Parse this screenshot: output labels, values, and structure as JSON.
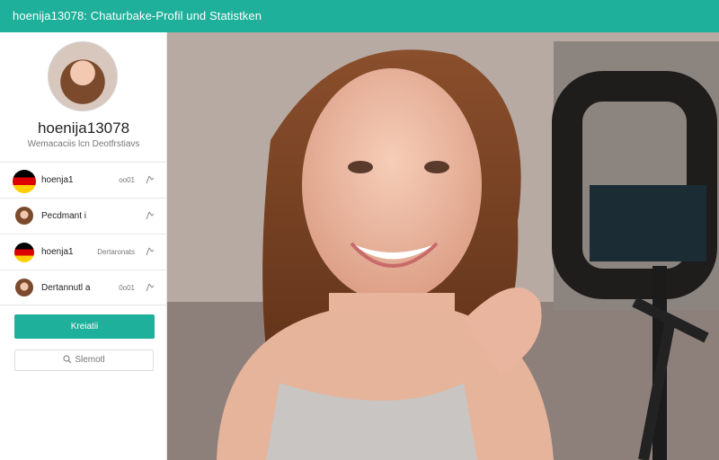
{
  "header": {
    "title": "hoenija13078: Chaturbake-Profil und Statistken"
  },
  "profile": {
    "username": "hoenija13078",
    "subtitle": "Wemacaciis lcn Deotfrstiavs"
  },
  "list": [
    {
      "icon": "germany-flag-icon",
      "name": "hoenja1",
      "meta": "oo01"
    },
    {
      "icon": "avatar-icon",
      "name": "Pecdmant i",
      "meta": ""
    },
    {
      "icon": "germany-flag-icon",
      "name": "hoenja1",
      "meta": "Dertaronats"
    },
    {
      "icon": "avatar-icon",
      "name": "Dertannutl a",
      "meta": "0o01"
    }
  ],
  "actions": {
    "primary_label": "Kreiatii"
  },
  "search": {
    "label": "Slemotl"
  },
  "colors": {
    "accent": "#1eb09a"
  }
}
